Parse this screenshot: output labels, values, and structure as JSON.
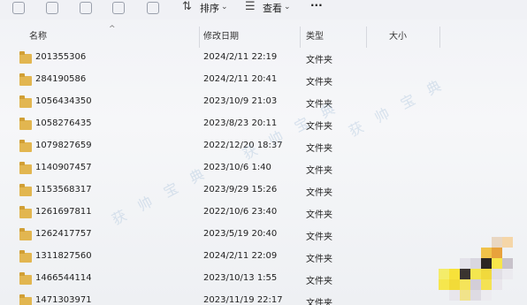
{
  "toolbar": {
    "sort_label": "排序",
    "view_label": "查看",
    "more_label": "···"
  },
  "columns": {
    "name": "名称",
    "modified": "修改日期",
    "type": "类型",
    "size": "大小"
  },
  "files": [
    {
      "name": "201355306",
      "modified": "2024/2/11 22:19",
      "type": "文件夹"
    },
    {
      "name": "284190586",
      "modified": "2024/2/11 20:41",
      "type": "文件夹"
    },
    {
      "name": "1056434350",
      "modified": "2023/10/9 21:03",
      "type": "文件夹"
    },
    {
      "name": "1058276435",
      "modified": "2023/8/23 20:11",
      "type": "文件夹"
    },
    {
      "name": "1079827659",
      "modified": "2022/12/20 18:37",
      "type": "文件夹"
    },
    {
      "name": "1140907457",
      "modified": "2023/10/6 1:40",
      "type": "文件夹"
    },
    {
      "name": "1153568317",
      "modified": "2023/9/29 15:26",
      "type": "文件夹"
    },
    {
      "name": "1261697811",
      "modified": "2022/10/6 23:40",
      "type": "文件夹"
    },
    {
      "name": "1262417757",
      "modified": "2023/5/19 20:40",
      "type": "文件夹"
    },
    {
      "name": "1311827560",
      "modified": "2024/2/11 22:09",
      "type": "文件夹"
    },
    {
      "name": "1466544114",
      "modified": "2023/10/13 1:55",
      "type": "文件夹"
    },
    {
      "name": "1471303971",
      "modified": "2023/11/19 22:17",
      "type": "文件夹"
    }
  ],
  "watermark": "获 帅 宝 典",
  "colors": {
    "folder": "#e2b650",
    "background": "#f3f4f7"
  }
}
